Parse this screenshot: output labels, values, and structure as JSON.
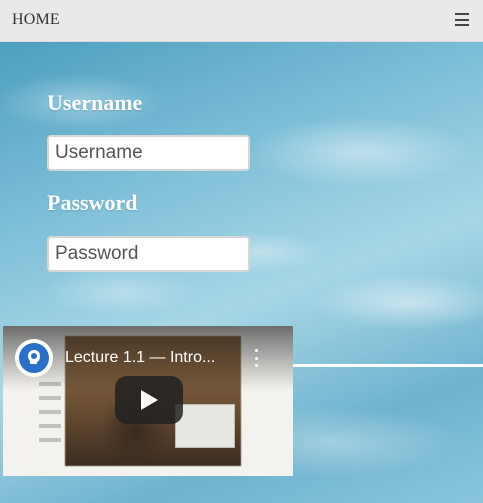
{
  "nav": {
    "home_label": "HOME",
    "menu_icon": "hamburger-menu-icon"
  },
  "login": {
    "username_label": "Username",
    "username_placeholder": "Username",
    "password_label": "Password",
    "password_placeholder": "Password"
  },
  "video": {
    "title": "Lecture 1.1 — Intro...",
    "channel_icon": "lightbulb-head-icon",
    "more_icon": "kebab-menu-icon",
    "play_icon": "play-icon"
  }
}
